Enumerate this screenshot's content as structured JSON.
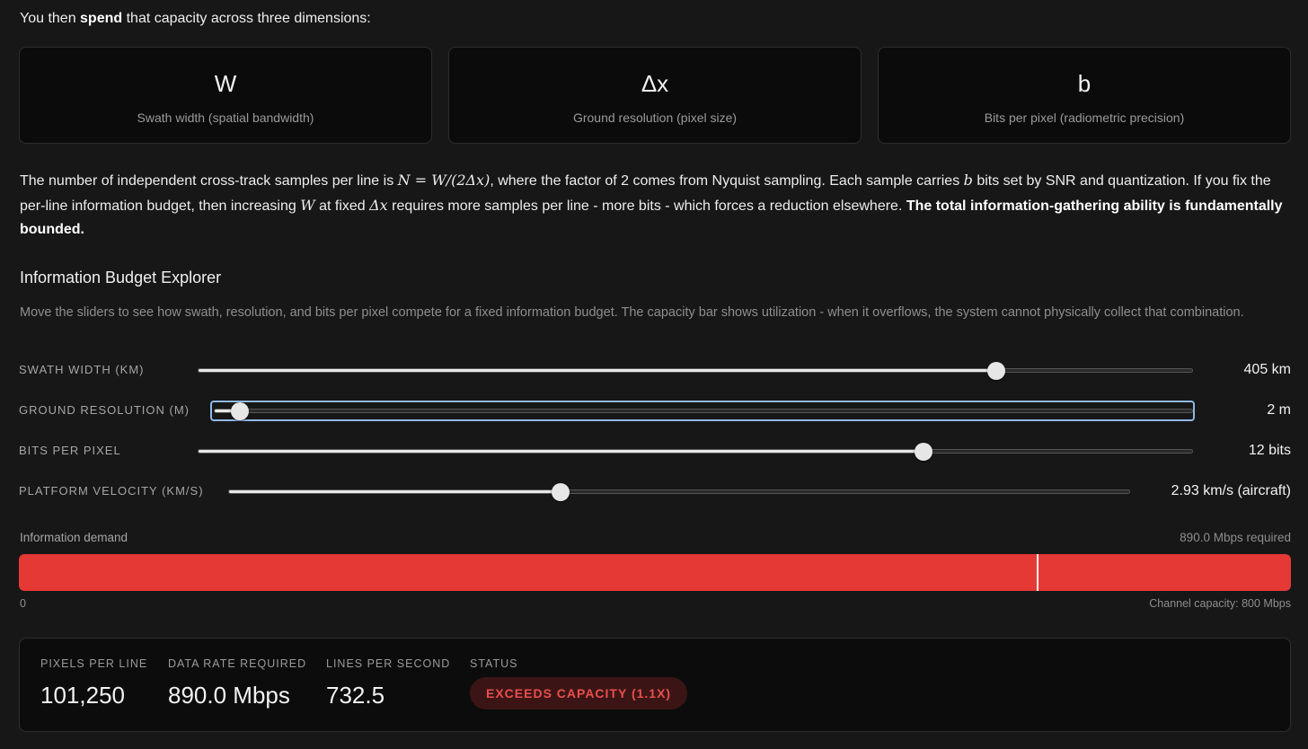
{
  "intro": {
    "before": "You then ",
    "bold": "spend",
    "after": " that capacity across three dimensions:"
  },
  "dimensions": [
    {
      "symbol": "W",
      "label": "Swath width (spatial bandwidth)"
    },
    {
      "symbol": "Δx",
      "label": "Ground resolution (pixel size)"
    },
    {
      "symbol": "b",
      "label": "Bits per pixel (radiometric precision)"
    }
  ],
  "paragraph": {
    "t1": "The number of independent cross-track samples per line is ",
    "m1": "N = W/(2Δx)",
    "t2": ", where the factor of 2 comes from Nyquist sampling. Each sample carries ",
    "m2": "b",
    "t3": " bits set by SNR and quantization. If you fix the per-line information budget, then increasing ",
    "m3": "W",
    "t4": " at fixed ",
    "m4": "Δx",
    "t5": " requires more samples per line - more bits - which forces a reduction elsewhere. ",
    "bold": "The total information-gathering ability is fundamentally bounded."
  },
  "explorer": {
    "title": "Information Budget Explorer",
    "description": "Move the sliders to see how swath, resolution, and bits per pixel compete for a fixed information budget. The capacity bar shows utilization - when it overflows, the system cannot physically collect that combination."
  },
  "sliders": [
    {
      "id": "swath",
      "label": "SWATH WIDTH (KM)",
      "value_text": "405 km",
      "fraction": 0.803
    },
    {
      "id": "resolution",
      "label": "GROUND RESOLUTION (M)",
      "value_text": "2 m",
      "fraction": 0.026
    },
    {
      "id": "bits",
      "label": "BITS PER PIXEL",
      "value_text": "12 bits",
      "fraction": 0.73
    },
    {
      "id": "velocity",
      "label": "PLATFORM VELOCITY (KM/S)",
      "value_text": "2.93 km/s (aircraft)",
      "fraction": 0.368
    }
  ],
  "capacity": {
    "demand_label": "Information demand",
    "required_text": "890.0 Mbps required",
    "fill_fraction": 1.0,
    "capacity_marker_fraction": 0.8,
    "fill_color": "#e53935",
    "scale_zero": "0",
    "scale_capacity": "Channel capacity: 800 Mbps"
  },
  "stats": {
    "pixels_per_line": {
      "label": "PIXELS PER LINE",
      "value": "101,250"
    },
    "data_rate": {
      "label": "DATA RATE REQUIRED",
      "value": "890.0 Mbps"
    },
    "lines_per_second": {
      "label": "LINES PER SECOND",
      "value": "732.5"
    },
    "status": {
      "label": "STATUS",
      "value": "EXCEEDS CAPACITY (1.1X)"
    }
  }
}
